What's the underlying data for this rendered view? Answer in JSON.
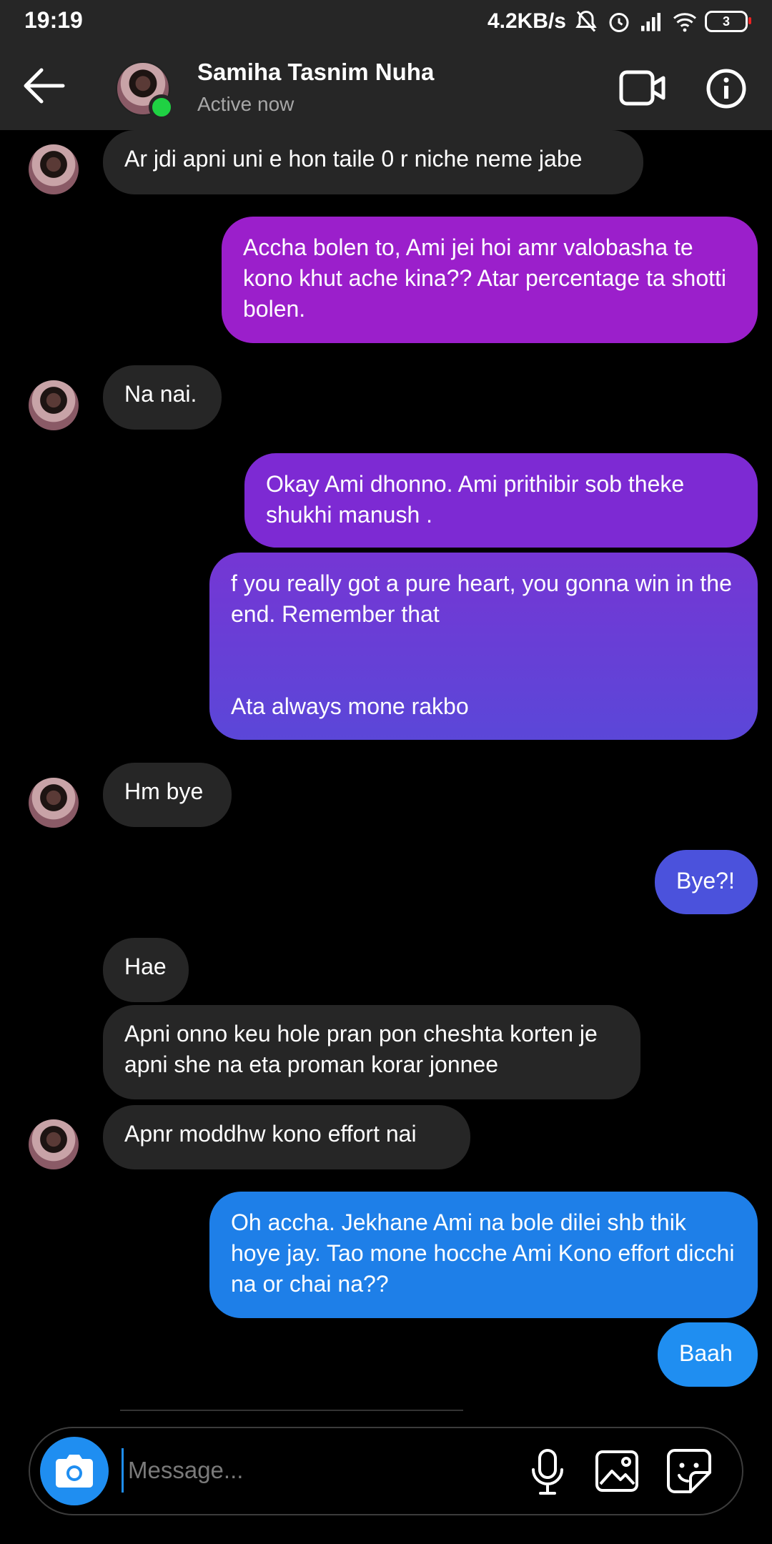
{
  "status_bar": {
    "time": "19:19",
    "network_speed": "4.2KB/s",
    "battery_level": "3",
    "icons": [
      "mute-bell-icon",
      "alarm-icon",
      "signal-icon",
      "wifi-icon",
      "battery-icon"
    ]
  },
  "header": {
    "contact_name": "Samiha Tasnim Nuha",
    "contact_status": "Active now",
    "icons": [
      "back-arrow-icon",
      "video-call-icon",
      "info-icon"
    ]
  },
  "messages": [
    {
      "sender": "them",
      "text": "Ar jdi apni uni e hon taile 0 r niche neme jabe"
    },
    {
      "sender": "me",
      "text": "Accha bolen to, Ami jei hoi amr valobasha te kono khut ache kina?? Atar percentage ta shotti bolen."
    },
    {
      "sender": "them",
      "text": "Na nai."
    },
    {
      "sender": "me",
      "text": "Okay Ami dhonno. Ami prithibir sob theke shukhi manush ."
    },
    {
      "sender": "me",
      "text": "f you really got a pure heart, you gonna win in the end. Remember that\n\n\nAta always mone rakbo"
    },
    {
      "sender": "them",
      "text": "Hm bye"
    },
    {
      "sender": "me",
      "text": "Bye?!"
    },
    {
      "sender": "them",
      "text": "Hae"
    },
    {
      "sender": "them",
      "text": "Apni onno keu hole pran pon cheshta korten je apni she na eta proman korar jonnee"
    },
    {
      "sender": "them",
      "text": "Apnr moddhw kono effort nai"
    },
    {
      "sender": "me",
      "text": "Oh accha. Jekhane Ami na bole dilei shb thik hoye jay. Tao mone hocche Ami Kono effort dicchi na or chai na??"
    },
    {
      "sender": "me",
      "text": "Baah"
    }
  ],
  "composer": {
    "placeholder": "Message...",
    "value": "",
    "icons": [
      "camera-icon",
      "microphone-icon",
      "gallery-icon",
      "sticker-icon"
    ]
  },
  "colors": {
    "background": "#000000",
    "incoming_bubble": "#262626",
    "outgoing_gradient_top": "#a21fd0",
    "outgoing_gradient_bottom": "#1f8ef1",
    "online_dot": "#1fd143",
    "accent": "#1f8ef1"
  }
}
